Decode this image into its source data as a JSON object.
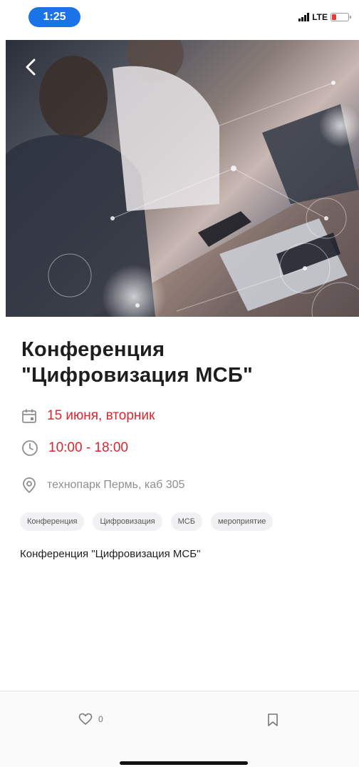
{
  "status_bar": {
    "time": "1:25",
    "network": "LTE",
    "battery_level": 0.25,
    "battery_color": "#e53935"
  },
  "hero": {
    "icon": "chevron-left-icon"
  },
  "event": {
    "title_line1": "Конференция",
    "title_line2": "\"Цифровизация МСБ\"",
    "date": "15 июня, вторник",
    "time": "10:00 - 18:00",
    "location": "технопарк Пермь, каб 305",
    "tags": [
      "Конференция",
      "Цифровизация",
      "МСБ",
      "мероприятие"
    ],
    "description": "Конференция \"Цифровизация МСБ\""
  },
  "bottom_bar": {
    "likes": "0"
  },
  "colors": {
    "accent": "#1b73e8",
    "date_text": "#e0242f",
    "muted": "#8f8f8f"
  }
}
